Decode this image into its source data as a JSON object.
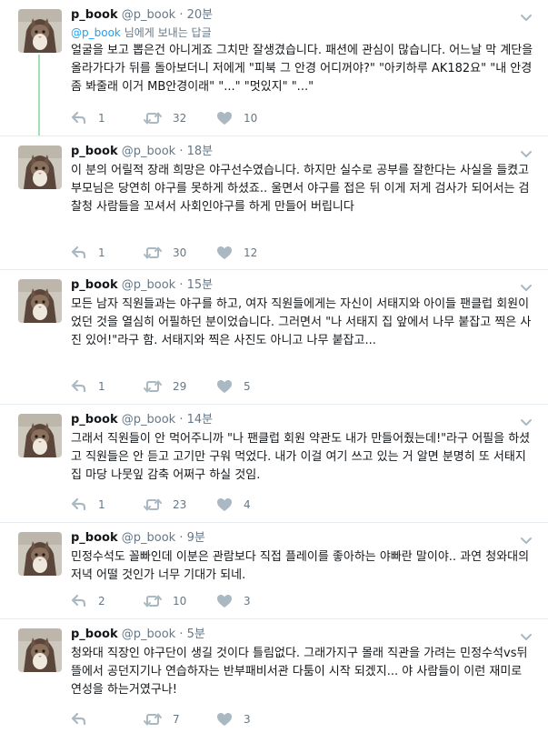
{
  "reply_context": {
    "mention": "@p_book",
    "suffix": " 님에게 보내는 답글"
  },
  "tweets": [
    {
      "name": "p_book",
      "handle": "@p_book",
      "time": "20분",
      "text": "얼굴을 보고 뽑은건 아니게죠 그치만 잘생겼습니다. 패션에 관심이 많습니다. 어느날 막 계단을 올라가다가 뒤를 돌아보더니 저에게 \"피북 그 안경 어디꺼야?\" \"아키하루 AK182요\" \"내 안경좀 봐줄래 이거 MB안경이래\" \"...\" \"멋있지\" \"...\"",
      "replies": "1",
      "retweets": "32",
      "likes": "10"
    },
    {
      "name": "p_book",
      "handle": "@p_book",
      "time": "18분",
      "text": "이 분의 어릴적 장래 희망은 야구선수였습니다. 하지만 실수로 공부를 잘한다는 사실을 들켰고 부모님은 당연히 야구를 못하게 하셨죠.. 울면서 야구를 접은 뒤 이게 저게 검사가 되어서는 검찰청 사람들을 꼬셔서 사회인야구를 하게 만들어 버립니다",
      "replies": "1",
      "retweets": "30",
      "likes": "12"
    },
    {
      "name": "p_book",
      "handle": "@p_book",
      "time": "15분",
      "text": "모든 남자 직원들과는 야구를 하고, 여자 직원들에게는 자신이 서태지와 아이들 팬클럽 회원이었던 것을 열심히 어필하던 분이었습니다. 그러면서 \"나 서태지 집 앞에서 나무 붙잡고 찍은 사진 있어!\"라구 함. 서태지와 찍은 사진도 아니고 나무 붙잡고...",
      "replies": "1",
      "retweets": "29",
      "likes": "5"
    },
    {
      "name": "p_book",
      "handle": "@p_book",
      "time": "14분",
      "text": "그래서 직원들이 안 먹어주니까 \"나 팬클럽 회원 약관도 내가 만들어줬는데!\"라구 어필을 하셨고 직원들은 안 듣고 고기만 구워 먹었다. 내가 이걸 여기 쓰고 있는 거 알면 분명히 또 서태지 집 마당 나뭇잎 감축 어쩌구 하실 것임.",
      "replies": "1",
      "retweets": "23",
      "likes": "4"
    },
    {
      "name": "p_book",
      "handle": "@p_book",
      "time": "9분",
      "text": "민정수석도 꼴빠인데 이분은 관람보다 직접 플레이를 좋아하는 야빠란 말이야.. 과연 청와대의 저녁 어떨 것인가 너무 기대가 되네.",
      "replies": "2",
      "retweets": "10",
      "likes": "3"
    },
    {
      "name": "p_book",
      "handle": "@p_book",
      "time": "5분",
      "text": "청와대 직장인 야구단이 생길 것이다 틀림없다. 그래가지구 몰래 직관을 가려는 민정수석vs뒤뜰에서 공던지기나 연습하자는 반부패비서관 다툼이 시작 되겠지... 야 사람들이 이런 재미로 연성을 하는거였구나!",
      "replies": "",
      "retweets": "7",
      "likes": "3"
    }
  ],
  "colors": {
    "text": "#14171a",
    "muted": "#657786",
    "link": "#1da1f2",
    "thread": "#a6dfb5",
    "divider": "#e6ecf0",
    "icon": "#aab8c2"
  },
  "icons": {
    "reply": "reply-icon",
    "retweet": "retweet-icon",
    "like": "heart-icon",
    "menu": "chevron-down-icon"
  }
}
